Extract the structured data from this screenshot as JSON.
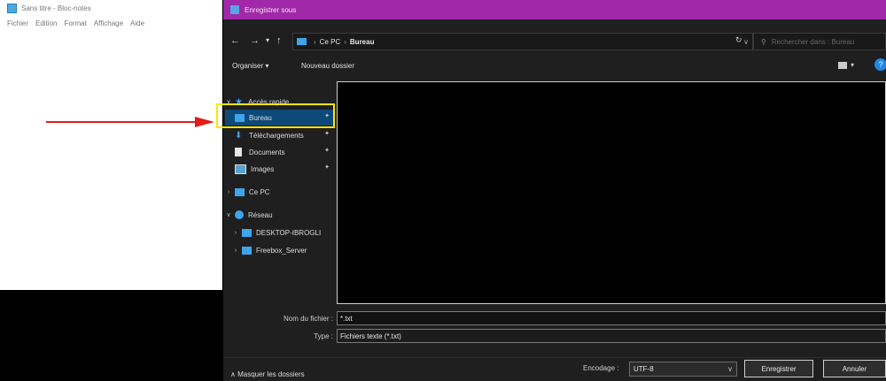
{
  "notepad": {
    "title": "Sans titre - Bloc-notes",
    "menu": [
      "Fichier",
      "Edition",
      "Format",
      "Affichage",
      "Aide"
    ]
  },
  "dialog": {
    "title": "Enregistrer sous",
    "nav": {
      "back": "←",
      "forward": "→",
      "recent": "▾",
      "up": "↑"
    },
    "address": {
      "root": "Ce PC",
      "current": "Bureau",
      "sep": "›"
    },
    "search_placeholder": "Rechercher dans : Bureau",
    "toolbar": {
      "organize": "Organiser ▾",
      "new_folder": "Nouveau dossier",
      "help": "?"
    },
    "tree": [
      {
        "label": "Accès rapide",
        "twisty": "∨",
        "icon": "star-icon",
        "pinned": false
      },
      {
        "label": "Bureau",
        "twisty": "",
        "icon": "desktop-folder-icon",
        "pinned": true,
        "selected": true
      },
      {
        "label": "Téléchargements",
        "twisty": "",
        "icon": "download-icon",
        "pinned": true
      },
      {
        "label": "Documents",
        "twisty": "",
        "icon": "document-icon",
        "pinned": true
      },
      {
        "label": "Images",
        "twisty": "",
        "icon": "image-icon",
        "pinned": true
      },
      {
        "label": "Ce PC",
        "twisty": "›",
        "icon": "computer-icon",
        "pinned": false
      },
      {
        "label": "Réseau",
        "twisty": "∨",
        "icon": "network-icon",
        "pinned": false
      },
      {
        "label": "DESKTOP-IBROGLI",
        "twisty": "›",
        "icon": "computer-icon",
        "pinned": false
      },
      {
        "label": "Freebox_Server",
        "twisty": "›",
        "icon": "computer-icon",
        "pinned": false
      }
    ],
    "form": {
      "filename_label": "Nom du fichier :",
      "filename_value": "*.txt",
      "type_label": "Type :",
      "type_value": "Fichiers texte (*.txt)"
    },
    "footer": {
      "hide_folders": "∧  Masquer les dossiers",
      "encoding_label": "Encodage :",
      "encoding_value": "UTF-8",
      "save": "Enregistrer",
      "cancel": "Annuler"
    }
  },
  "colors": {
    "title_accent": "#a128a8",
    "highlight": "#ffe600",
    "arrow": "#e21b1b"
  }
}
